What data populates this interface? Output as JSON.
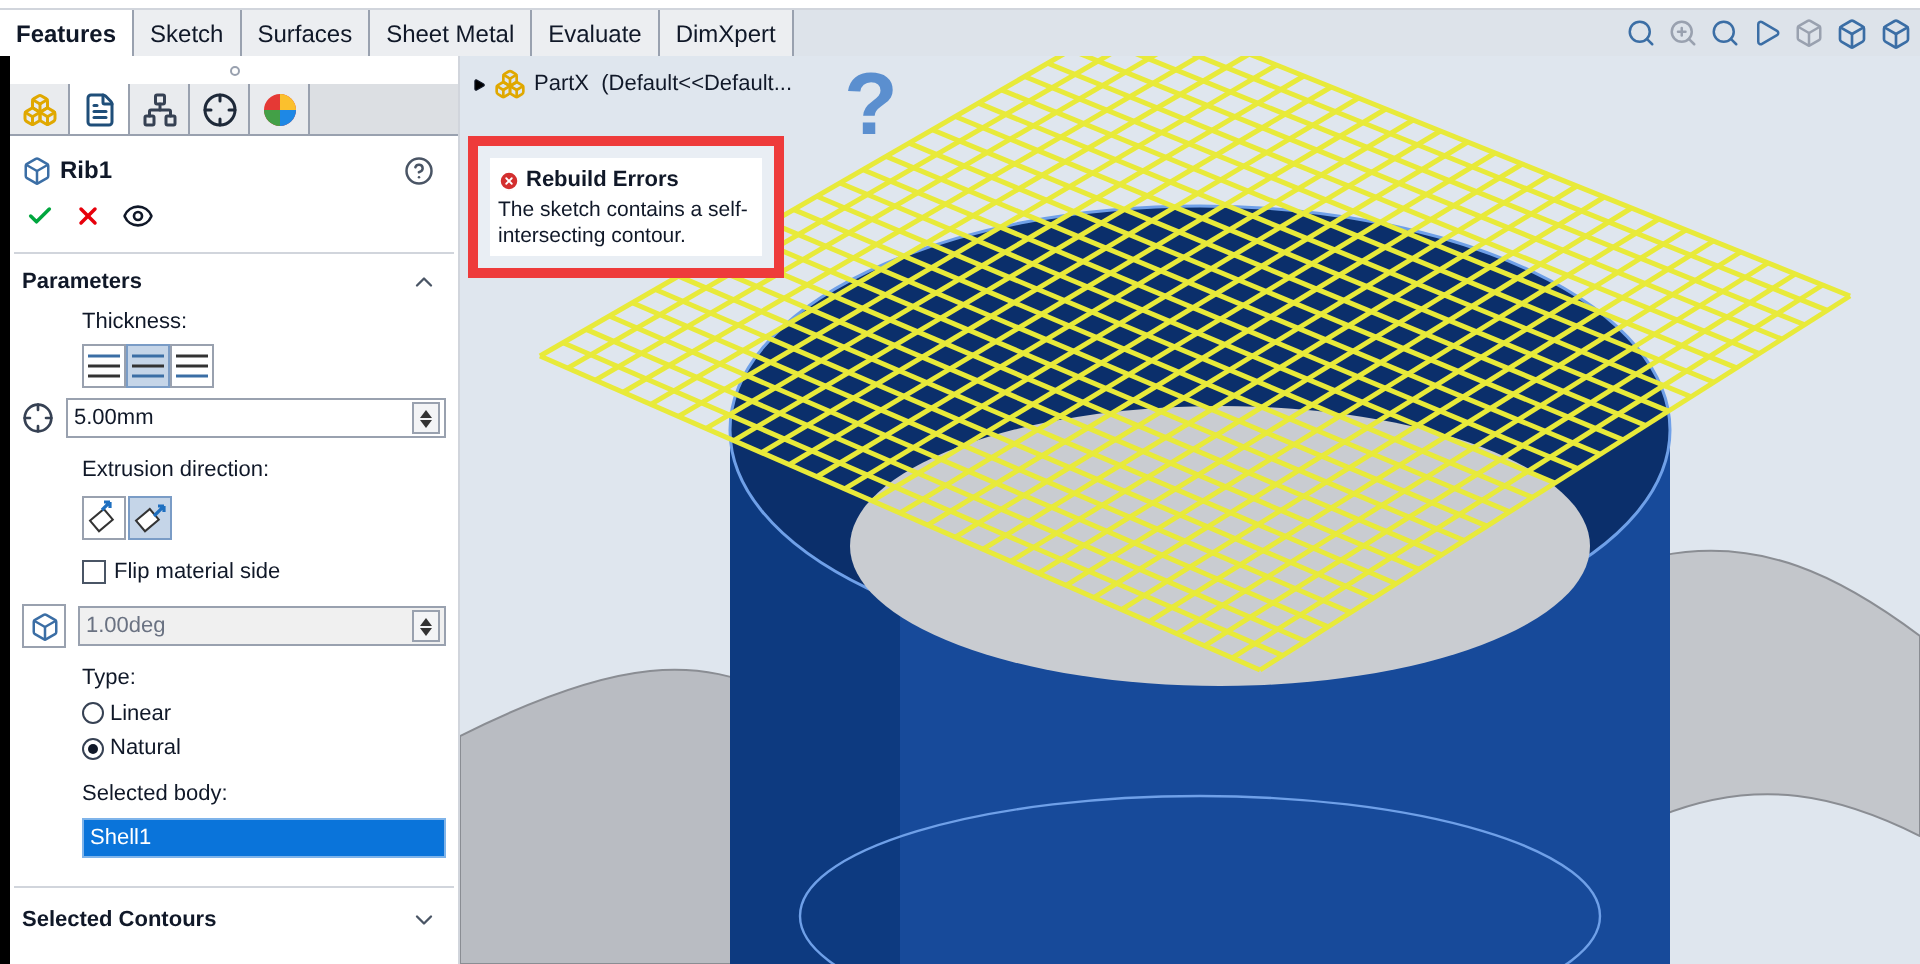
{
  "tabs": [
    {
      "label": "Features",
      "selected": true
    },
    {
      "label": "Sketch",
      "selected": false
    },
    {
      "label": "Surfaces",
      "selected": false
    },
    {
      "label": "Sheet Metal",
      "selected": false
    },
    {
      "label": "Evaluate",
      "selected": false
    },
    {
      "label": "DimXpert",
      "selected": false
    }
  ],
  "panel_tabs": [
    {
      "kind": "feature_manager",
      "selected": false
    },
    {
      "kind": "property_manager",
      "selected": true
    },
    {
      "kind": "configuration_manager",
      "selected": false
    },
    {
      "kind": "dimxpert_manager",
      "selected": false
    },
    {
      "kind": "display_manager",
      "selected": false
    }
  ],
  "feature": {
    "name": "Rib1"
  },
  "parameters": {
    "title": "Parameters",
    "expanded": true,
    "thickness_label": "Thickness:",
    "thickness_options": [
      {
        "kind": "first_side",
        "selected": false
      },
      {
        "kind": "both_sides",
        "selected": true
      },
      {
        "kind": "second_side",
        "selected": false
      }
    ],
    "thickness_value": "5.00mm",
    "extrusion_label": "Extrusion direction:",
    "extrusion_options": [
      {
        "kind": "parallel",
        "selected": false
      },
      {
        "kind": "normal",
        "selected": true
      }
    ],
    "flip": {
      "label": "Flip material side",
      "checked": false
    },
    "draft": {
      "value": "1.00deg",
      "disabled": true
    },
    "type_label": "Type:",
    "types": [
      {
        "label": "Linear",
        "selected": false
      },
      {
        "label": "Natural",
        "selected": true
      }
    ],
    "body_label": "Selected body:",
    "body_value": "Shell1"
  },
  "selected_contours": {
    "title": "Selected Contours",
    "expanded": false
  },
  "tree": {
    "label": "PartX  (Default<<Default..."
  },
  "help_marker": "?",
  "error_tooltip": {
    "title": "Rebuild Errors",
    "message": "The sketch contains a self-intersecting contour."
  }
}
